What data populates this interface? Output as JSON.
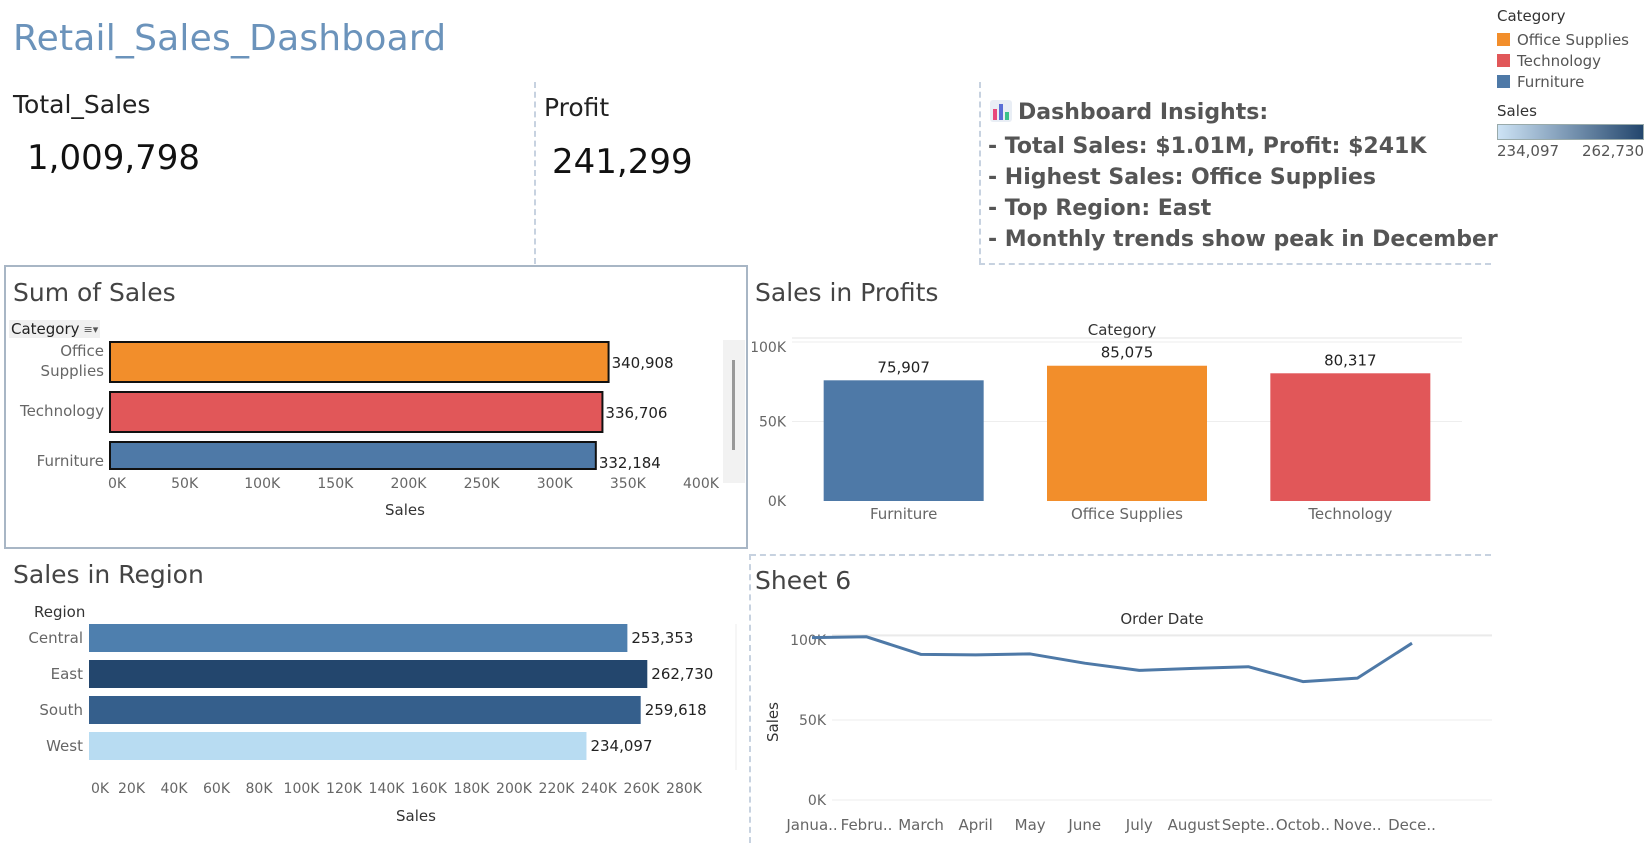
{
  "dashboard": {
    "title": "Retail_Sales_Dashboard"
  },
  "kpis": {
    "total_sales": {
      "label": "Total_Sales",
      "value": "1,009,798"
    },
    "profit": {
      "label": "Profit",
      "value": "241,299"
    }
  },
  "insights": {
    "icon": "bar-chart-icon",
    "heading": "Dashboard Insights:",
    "lines": [
      "- Total Sales: $1.01M, Profit: $241K",
      "- Highest Sales: Office Supplies",
      "- Top Region: East",
      "- Monthly trends show peak in December"
    ]
  },
  "legend": {
    "category_title": "Category",
    "categories": [
      {
        "name": "Office Supplies",
        "color": "#f28e2b"
      },
      {
        "name": "Technology",
        "color": "#e15759"
      },
      {
        "name": "Furniture",
        "color": "#4e79a7"
      }
    ],
    "sales_title": "Sales",
    "sales_min": "234,097",
    "sales_max": "262,730"
  },
  "panels": {
    "sum_of_sales": {
      "title": "Sum of Sales",
      "header": "Category"
    },
    "sales_in_profits": {
      "title": "Sales in Profits"
    },
    "sales_in_region": {
      "title": "Sales in Region"
    },
    "sheet6": {
      "title": "Sheet 6"
    }
  },
  "chart_data": [
    {
      "id": "sum_of_sales",
      "type": "bar",
      "orientation": "horizontal",
      "categories": [
        "Office\nSupplies",
        "Technology",
        "Furniture"
      ],
      "values": [
        340908,
        336706,
        332184
      ],
      "labels": [
        "340,908",
        "336,706",
        "332,184"
      ],
      "colors": [
        "#f28e2b",
        "#e15759",
        "#4e79a7"
      ],
      "xlabel": "Sales",
      "xticks": [
        "0K",
        "50K",
        "100K",
        "150K",
        "200K",
        "250K",
        "300K",
        "350K",
        "400K"
      ],
      "xlim": [
        0,
        400000
      ]
    },
    {
      "id": "sales_in_profits",
      "type": "bar",
      "categories": [
        "Furniture",
        "Office Supplies",
        "Technology"
      ],
      "values": [
        75907,
        85075,
        80317
      ],
      "labels": [
        "75,907",
        "85,075",
        "80,317"
      ],
      "colors": [
        "#4e79a7",
        "#f28e2b",
        "#e15759"
      ],
      "xlabel": "Category",
      "yticks": [
        "0K",
        "50K",
        "100K"
      ],
      "ylim": [
        0,
        100000
      ]
    },
    {
      "id": "sales_in_region",
      "type": "bar",
      "orientation": "horizontal",
      "categories": [
        "Central",
        "East",
        "South",
        "West"
      ],
      "values": [
        253353,
        262730,
        259618,
        234097
      ],
      "labels": [
        "253,353",
        "262,730",
        "259,618",
        "234,097"
      ],
      "colors": [
        "#4e7fae",
        "#23466d",
        "#355f8c",
        "#b8dcf2"
      ],
      "ylabel": "Region",
      "xlabel": "Sales",
      "xticks": [
        "0K",
        "20K",
        "40K",
        "60K",
        "80K",
        "100K",
        "120K",
        "140K",
        "160K",
        "180K",
        "200K",
        "220K",
        "240K",
        "260K",
        "280K"
      ],
      "xlim": [
        0,
        280000
      ]
    },
    {
      "id": "sheet6",
      "type": "line",
      "categories": [
        "Janua..",
        "Febru..",
        "March",
        "April",
        "May",
        "June",
        "July",
        "August",
        "Septe..",
        "Octob..",
        "Nove..",
        "Dece.."
      ],
      "values": [
        99000,
        99500,
        88500,
        88200,
        88800,
        83000,
        78500,
        79800,
        80800,
        71500,
        73700,
        95500
      ],
      "xlabel": "Order Date",
      "ylabel": "Sales",
      "yticks": [
        "0K",
        "50K",
        "100K"
      ],
      "ylim": [
        0,
        100000
      ],
      "color": "#4e79a7"
    }
  ]
}
